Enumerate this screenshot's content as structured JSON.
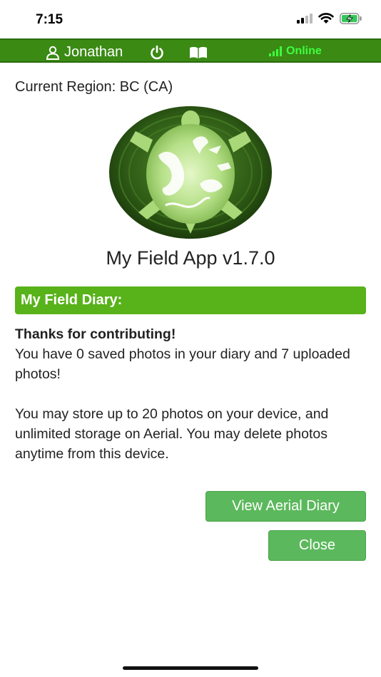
{
  "status_bar": {
    "time": "7:15"
  },
  "app_bar": {
    "user_name": "Jonathan",
    "online_label": "Online",
    "colors": {
      "bar": "#3a8a14",
      "online": "#3fff3f"
    }
  },
  "region": {
    "text": "Current Region: BC (CA)"
  },
  "app": {
    "title": "My Field App v1.7.0"
  },
  "diary": {
    "header": "My Field Diary:",
    "thanks": "Thanks for contributing!",
    "saved_text": "You have 0 saved photos in your diary and 7 uploaded photos!",
    "storage_text": "You may store up to 20 photos on your device, and unlimited storage on Aerial. You may delete photos anytime from this device."
  },
  "buttons": {
    "view_aerial": "View Aerial Diary",
    "close": "Close"
  },
  "colors": {
    "accent": "#58b21a",
    "button": "#5cb85c"
  }
}
